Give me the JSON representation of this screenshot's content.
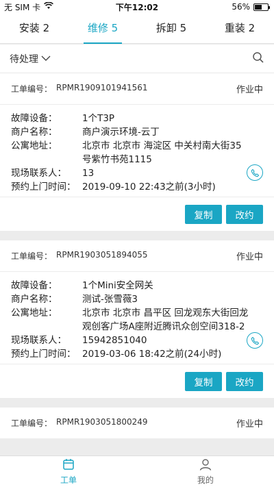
{
  "status_bar": {
    "carrier": "无 SIM 卡",
    "time": "下午12:02",
    "battery": "56%",
    "battery_level": 0.56
  },
  "tabs": [
    {
      "label": "安装 2",
      "active": false
    },
    {
      "label": "维修 5",
      "active": true
    },
    {
      "label": "拆卸 5",
      "active": false
    },
    {
      "label": "重装 2",
      "active": false
    }
  ],
  "filter": {
    "selected": "待处理"
  },
  "labels": {
    "order_no": "工单编号：",
    "device": "故障设备：",
    "merchant": "商户名称：",
    "address": "公寓地址：",
    "contact": "现场联系人：",
    "appointment": "预约上门时间："
  },
  "orders": [
    {
      "order_no": "RPMR1909101941561",
      "status": "作业中",
      "device": "1个T3P",
      "merchant": "商户演示环境-云丁",
      "address": "北京市 北京市 海淀区 中关村南大街35号紫竹书苑1115",
      "contact": "13",
      "appointment": "2019-09-10 22:43之前(3小时)",
      "copy_label": "复制",
      "reschedule_label": "改约"
    },
    {
      "order_no": "RPMR1903051894055",
      "status": "作业中",
      "device": "1个Mini安全网关",
      "merchant": "测试-张雪薇3",
      "address": "北京市 北京市 昌平区 回龙观东大街回龙观创客广场A座附近腾讯众创空间318-2",
      "contact": "15942851040",
      "appointment": "2019-03-06 18:42之前(24小时)",
      "copy_label": "复制",
      "reschedule_label": "改约"
    },
    {
      "order_no": "RPMR1903051800249",
      "status": "作业中"
    }
  ],
  "bottom_nav": [
    {
      "label": "工单",
      "icon": "calendar-icon",
      "active": true
    },
    {
      "label": "我的",
      "icon": "person-icon",
      "active": false
    }
  ],
  "colors": {
    "accent": "#1aa6c4"
  }
}
